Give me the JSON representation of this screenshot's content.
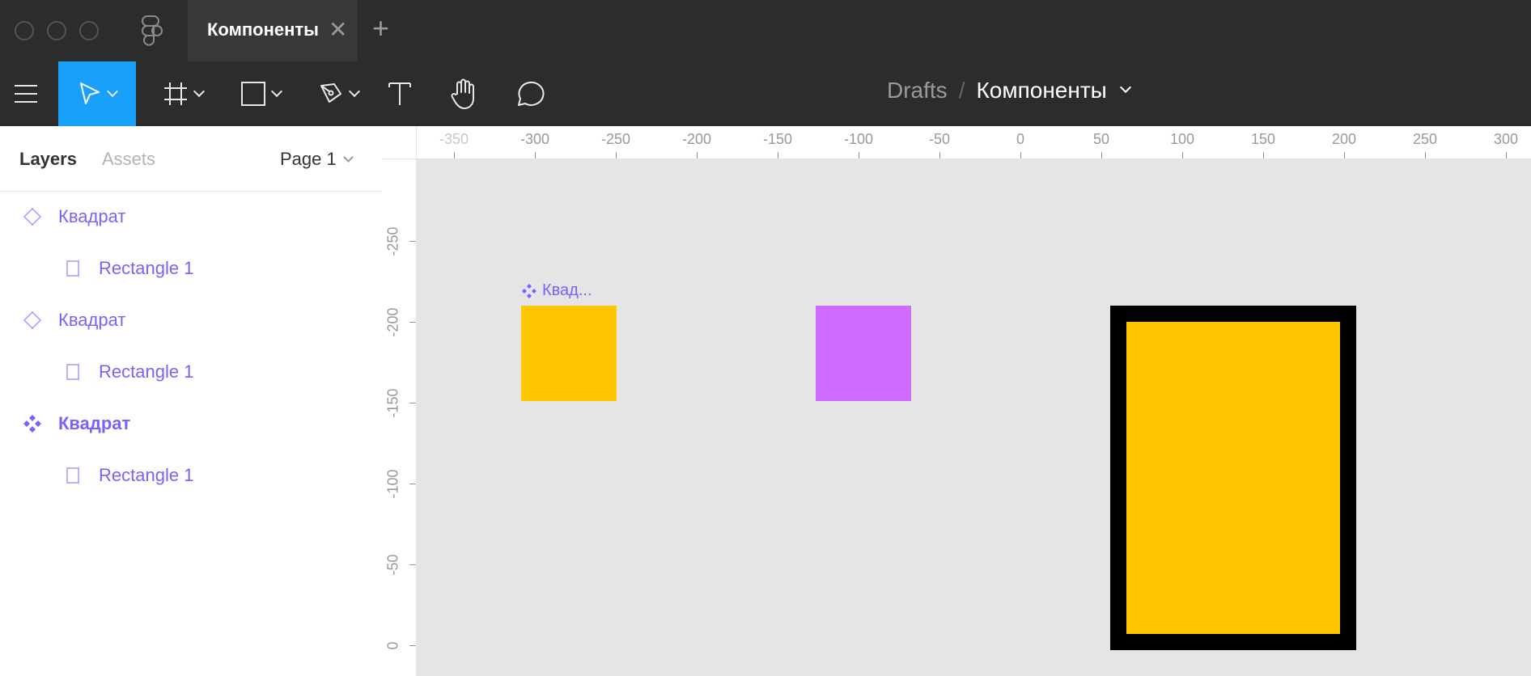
{
  "window": {
    "tab_title": "Компоненты",
    "tab_close": "✕",
    "tab_add": "+"
  },
  "toolbar": {
    "breadcrumb_parent": "Drafts",
    "breadcrumb_separator": "/",
    "file_name": "Компоненты",
    "active_tool_color": "#18a0fb"
  },
  "left_panel": {
    "tab_layers": "Layers",
    "tab_assets": "Assets",
    "page_selector": "Page 1",
    "layers": [
      {
        "label": "Квадрат",
        "icon": "component-instance-icon",
        "indent": false,
        "bold": false
      },
      {
        "label": "Rectangle 1",
        "icon": "rectangle-icon",
        "indent": true,
        "bold": false
      },
      {
        "label": "Квадрат",
        "icon": "component-instance-icon",
        "indent": false,
        "bold": false
      },
      {
        "label": "Rectangle 1",
        "icon": "rectangle-icon",
        "indent": true,
        "bold": false
      },
      {
        "label": "Квадрат",
        "icon": "main-component-icon",
        "indent": false,
        "bold": true
      },
      {
        "label": "Rectangle 1",
        "icon": "rectangle-icon",
        "indent": true,
        "bold": false
      }
    ]
  },
  "rulers": {
    "x_ticks": [
      "-350",
      "-300",
      "-250",
      "-200",
      "-150",
      "-100",
      "-50",
      "0",
      "50",
      "100",
      "150",
      "200",
      "250",
      "300"
    ],
    "y_ticks": [
      "-250",
      "-200",
      "-150",
      "-100",
      "-50",
      "0"
    ]
  },
  "canvas": {
    "component_label": "Квад...",
    "colors": {
      "yellow": "#ffc700",
      "purple": "#d06cff",
      "border": "#000000",
      "accent": "#7b61ff"
    }
  }
}
